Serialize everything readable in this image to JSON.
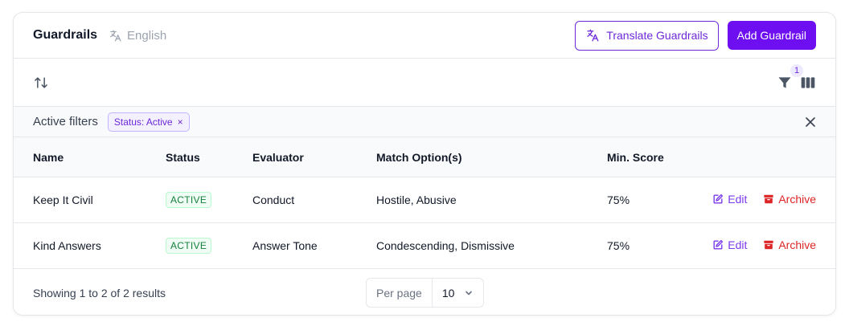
{
  "header": {
    "title": "Guardrails",
    "language": "English",
    "translate_label": "Translate Guardrails",
    "add_label": "Add Guardrail"
  },
  "toolbar": {
    "filter_count": "1"
  },
  "filters": {
    "label": "Active filters",
    "chips": [
      {
        "label": "Status: Active",
        "remove": "×"
      }
    ]
  },
  "table": {
    "columns": [
      "Name",
      "Status",
      "Evaluator",
      "Match Option(s)",
      "Min. Score"
    ],
    "rows": [
      {
        "name": "Keep It Civil",
        "status": "ACTIVE",
        "evaluator": "Conduct",
        "match": "Hostile, Abusive",
        "score": "75%",
        "edit": "Edit",
        "archive": "Archive"
      },
      {
        "name": "Kind Answers",
        "status": "ACTIVE",
        "evaluator": "Answer Tone",
        "match": "Condescending, Dismissive",
        "score": "75%",
        "edit": "Edit",
        "archive": "Archive"
      }
    ]
  },
  "footer": {
    "results": "Showing 1 to 2 of 2 results",
    "per_page_label": "Per page",
    "per_page_value": "10"
  },
  "colors": {
    "accent": "#6d0ff0",
    "accent_text": "#6d28d9",
    "active": "#15803d",
    "danger": "#dc2626"
  }
}
